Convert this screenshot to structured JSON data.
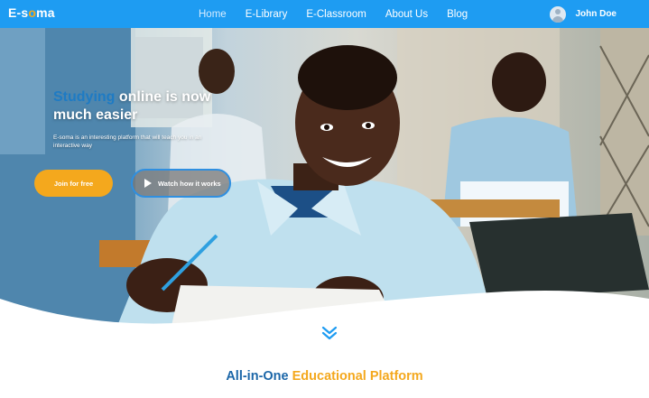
{
  "header": {
    "logo_prefix": "E-s",
    "logo_o": "o",
    "logo_suffix": "ma",
    "nav": [
      {
        "label": "Home",
        "active": true
      },
      {
        "label": "E-Library"
      },
      {
        "label": "E-Classroom"
      },
      {
        "label": "About Us"
      },
      {
        "label": "Blog"
      }
    ],
    "user_name": "John Doe",
    "user_icon": "user-avatar-icon"
  },
  "hero": {
    "title_highlight": "Studying",
    "title_rest": " online is now much easier",
    "subtitle": "E-soma is an interesting platform that will teach you in an interactive way",
    "join_label": "Join for free",
    "watch_label": "Watch how it works",
    "watch_icon": "play-icon"
  },
  "scroll_icon": "double-chevron-down-icon",
  "section": {
    "title_part1": "All-in-One",
    "title_part2": "Educational Platform"
  },
  "colors": {
    "primary": "#1e9cf2",
    "accent": "#f4a81d",
    "title_blue": "#1b66a8"
  }
}
